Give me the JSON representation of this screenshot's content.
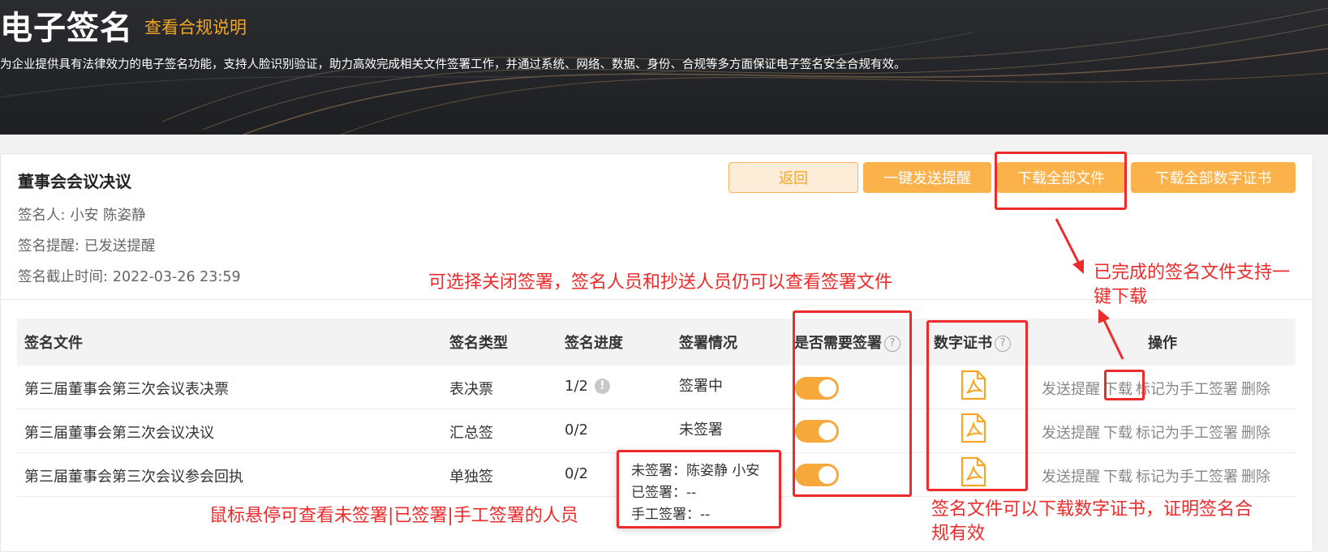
{
  "header": {
    "title": "电子签名",
    "compliance_link": "查看合规说明",
    "description": "为企业提供具有法律效力的电子签名功能，支持人脸识别验证，助力高效完成相关文件签署工作，并通过系统、网络、数据、身份、合规等多方面保证电子签名安全合规有效。"
  },
  "document": {
    "title": "董事会会议决议",
    "signers_label": "签名人:",
    "signers_value": "小安 陈姿静",
    "reminder_label": "签名提醒:",
    "reminder_value": "已发送提醒",
    "deadline_label": "签名截止时间:",
    "deadline_value": "2022-03-26 23:59"
  },
  "actions": {
    "back": "返回",
    "send_reminder": "一键发送提醒",
    "download_all": "下载全部文件",
    "download_all_certs": "下载全部数字证书"
  },
  "table": {
    "headers": {
      "file": "签名文件",
      "type": "签名类型",
      "progress": "签名进度",
      "status": "签署情况",
      "need_sign": "是否需要签署",
      "cert": "数字证书",
      "ops": "操作"
    },
    "help_glyph": "?",
    "info_glyph": "!",
    "rows": [
      {
        "file": "第三届董事会第三次会议表决票",
        "type": "表决票",
        "progress": "1/2",
        "status": "签署中",
        "need_sign": true
      },
      {
        "file": "第三届董事会第三次会议决议",
        "type": "汇总签",
        "progress": "0/2",
        "status": "未签署",
        "need_sign": true
      },
      {
        "file": "第三届董事会第三次会议参会回执",
        "type": "单独签",
        "progress": "0/2",
        "status": "",
        "need_sign": true
      }
    ],
    "row_ops": {
      "send": "发送提醒",
      "download": "下载",
      "mark_manual": "标记为手工签署",
      "delete": "删除"
    }
  },
  "tooltip": {
    "unsigned": "未签署：陈姿静 小安",
    "signed": "已签署：--",
    "manual": "手工签署：--"
  },
  "annotations": {
    "close_signing": "可选择关闭签署，签名人员和抄送人员仍可以查看签署文件",
    "download_note_line1": "已完成的签名文件支持一",
    "download_note_line2": "键下载",
    "hover_note": "鼠标悬停可查看未签署|已签署|手工签署的人员",
    "cert_note_line1": "签名文件可以下载数字证书，证明签名合",
    "cert_note_line2": "规有效"
  },
  "colors": {
    "accent": "#f5a623",
    "button": "#fbb24a",
    "annotation": "#ee2b2b",
    "banner": "#1e1f22"
  },
  "icons": [
    "help-circle-icon",
    "info-circle-icon",
    "pdf-file-icon",
    "toggle-switch-icon"
  ]
}
